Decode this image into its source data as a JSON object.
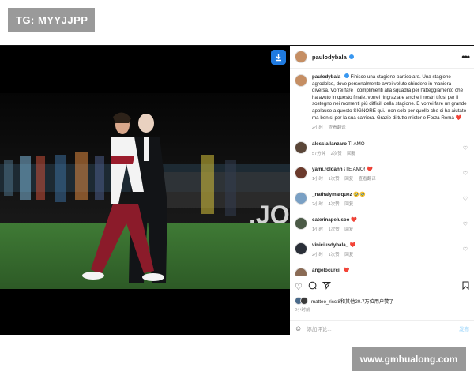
{
  "watermark_top": "TG: MYYJJPP",
  "watermark_bottom": "www.gmhualong.com",
  "post": {
    "username": "paulodybala",
    "caption_user": "paulodybala",
    "caption_text": "Finisce una stagione particolare. Una stagione agrodolce, dove personalmente avrei voluto chiudere in maniera diversa. Vorrei fare i complimenti alla squadra per l'atteggiamento che ha avuto in questo finale, vorrei ringraziare anche i nostri tifosi per il sostegno nei momenti più difficili della stagione. E vorrei fare un grande applauso a questo SIGNORE qui.. non solo per quello che ci ha aiutato ma ben si per la sua carriera. Grazie di tutto mister e Forza Roma ❤️",
    "caption_time": "2小时",
    "caption_translate": "查看翻译"
  },
  "comments": [
    {
      "user": "alessia.lanzaro",
      "text": "TI AMO",
      "time": "57分钟",
      "likes": "2次赞",
      "reply": "回复",
      "translate": ""
    },
    {
      "user": "yami.roldann",
      "text": "¡TE AMO! ❤️",
      "time": "1小时",
      "likes": "1次赞",
      "reply": "回复",
      "translate": "查看翻译"
    },
    {
      "user": "_nathalymarquez",
      "text": "🥹🥹",
      "time": "2小时",
      "likes": "4次赞",
      "reply": "回复",
      "translate": ""
    },
    {
      "user": "caterinapelusoo",
      "text": "❤️",
      "time": "1小时",
      "likes": "1次赞",
      "reply": "回复",
      "translate": ""
    },
    {
      "user": "viniciusdybala_",
      "text": "❤️",
      "time": "2小时",
      "likes": "1次赞",
      "reply": "回复",
      "translate": ""
    },
    {
      "user": "angelocurci_",
      "text": "❤️",
      "time": "",
      "likes": "",
      "reply": "",
      "translate": ""
    }
  ],
  "likes_text": "matteo_ricci8和其他20.7万位用户赞了",
  "date_text": "2小时前",
  "add_comment_placeholder": "添加评论...",
  "post_button": "发布",
  "colors": {
    "verified": "#3897f0",
    "download": "#1f7ae0",
    "heart": "#ed4956"
  },
  "icons": [
    "download-icon",
    "more-icon",
    "heart-icon",
    "comment-icon",
    "share-icon",
    "save-icon",
    "emoji-icon"
  ]
}
